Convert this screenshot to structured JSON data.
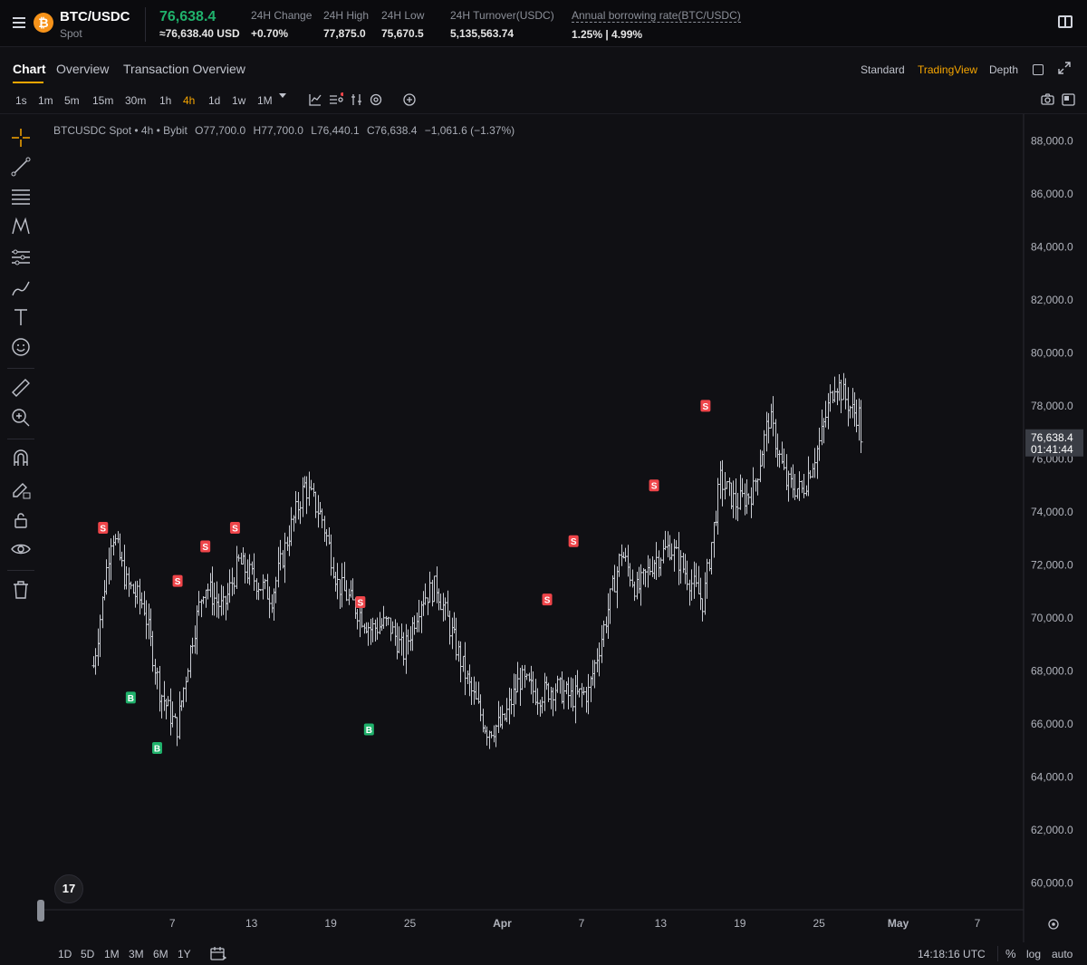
{
  "ticker": {
    "pair": "BTC/USDC",
    "market": "Spot",
    "coin_glyph": "₿",
    "last_price": "76,638.4",
    "last_price_usd": "≈76,638.40 USD",
    "stats": [
      {
        "label": "24H Change",
        "value": "+0.70%"
      },
      {
        "label": "24H High",
        "value": "77,875.0"
      },
      {
        "label": "24H Low",
        "value": "75,670.5"
      },
      {
        "label": "24H Turnover(USDC)",
        "value": "5,135,563.74"
      },
      {
        "label": "Annual borrowing rate(BTC/USDC)",
        "value": "1.25% | 4.99%"
      }
    ]
  },
  "tabs": [
    "Chart",
    "Overview",
    "Transaction Overview"
  ],
  "view_options": [
    "Standard",
    "TradingView",
    "Depth"
  ],
  "intervals": [
    "1s",
    "1m",
    "5m",
    "15m",
    "30m",
    "1h",
    "4h",
    "1d",
    "1w",
    "1M"
  ],
  "active_interval": "4h",
  "legend": {
    "symbol": "BTCUSDC Spot • 4h • Bybit",
    "open": "O77,700.0",
    "high": "H77,700.0",
    "low": "L76,440.1",
    "close": "C76,638.4",
    "change": "−1,061.6 (−1.37%)"
  },
  "price_label": {
    "price": "76,638.4",
    "countdown": "01:41:44"
  },
  "tv_logo": "17",
  "range_buttons": [
    "1D",
    "5D",
    "1M",
    "3M",
    "6M",
    "1Y"
  ],
  "clock": "14:18:16 UTC",
  "scale_options": {
    "percent": "%",
    "log": "log",
    "auto": "auto"
  },
  "colors": {
    "up": "#20b26c",
    "down": "#ef454a",
    "accent": "#f7a600",
    "bar": "#c8cbd2"
  },
  "chart_data": {
    "type": "ohlc",
    "interval": "4h",
    "ylim": [
      59000,
      89000
    ],
    "y_ticks": [
      88000,
      86000,
      84000,
      82000,
      80000,
      78000,
      76000,
      74000,
      72000,
      70000,
      68000,
      66000,
      64000,
      62000,
      60000
    ],
    "y_tick_labels": [
      "88,000.0",
      "86,000.0",
      "84,000.0",
      "82,000.0",
      "80,000.0",
      "78,000.0",
      "76,000.0",
      "74,000.0",
      "72,000.0",
      "70,000.0",
      "68,000.0",
      "66,000.0",
      "64,000.0",
      "62,000.0",
      "60,000.0"
    ],
    "x_ticks": [
      "7",
      "13",
      "19",
      "25",
      "Apr",
      "7",
      "13",
      "19",
      "25",
      "May",
      "7"
    ],
    "x_tick_days": [
      6,
      12,
      18,
      24,
      31,
      37,
      43,
      49,
      55,
      61,
      67
    ],
    "x_range_days": [
      -3.9,
      70.5
    ],
    "price_path_days": [
      0,
      1.4,
      1.8,
      2.5,
      3.8,
      5,
      6.3,
      7.5,
      8.4,
      9.8,
      11,
      12.3,
      13.5,
      14.7,
      16,
      17.3,
      18.5,
      19.7,
      21,
      22.3,
      23.5,
      24.8,
      26,
      27.3,
      28.5,
      29.8,
      31,
      32.3,
      33.7,
      35,
      36.2,
      37.5,
      38.7,
      40,
      41.2,
      42.5,
      43.7,
      45,
      46.2,
      47.5,
      48.7,
      50,
      51.2,
      52.5,
      53.7,
      55,
      56.2,
      57.5,
      58.2
    ],
    "price_path_values": [
      68200,
      73300,
      72600,
      71300,
      70500,
      67300,
      65800,
      69300,
      71300,
      70300,
      72100,
      71400,
      70800,
      73000,
      75000,
      73800,
      71300,
      70500,
      69600,
      69800,
      68700,
      70700,
      71200,
      69200,
      67400,
      65800,
      66000,
      67700,
      67100,
      67400,
      67000,
      67200,
      69700,
      72500,
      71000,
      72200,
      72700,
      71600,
      70600,
      75200,
      74300,
      74800,
      77600,
      75100,
      74800,
      76600,
      79000,
      77800,
      77600
    ],
    "last_price": 76638.4,
    "signals": [
      {
        "type": "S",
        "day": 0.75,
        "price": 73400
      },
      {
        "type": "B",
        "day": 2.85,
        "price": 67000
      },
      {
        "type": "B",
        "day": 4.85,
        "price": 65100
      },
      {
        "type": "S",
        "day": 6.4,
        "price": 71400
      },
      {
        "type": "S",
        "day": 8.5,
        "price": 72700
      },
      {
        "type": "S",
        "day": 10.75,
        "price": 73400
      },
      {
        "type": "S",
        "day": 20.25,
        "price": 70600
      },
      {
        "type": "B",
        "day": 20.9,
        "price": 65800
      },
      {
        "type": "S",
        "day": 34.4,
        "price": 70700
      },
      {
        "type": "S",
        "day": 36.4,
        "price": 72900
      },
      {
        "type": "S",
        "day": 42.5,
        "price": 75000
      },
      {
        "type": "S",
        "day": 46.4,
        "price": 78000
      }
    ]
  }
}
